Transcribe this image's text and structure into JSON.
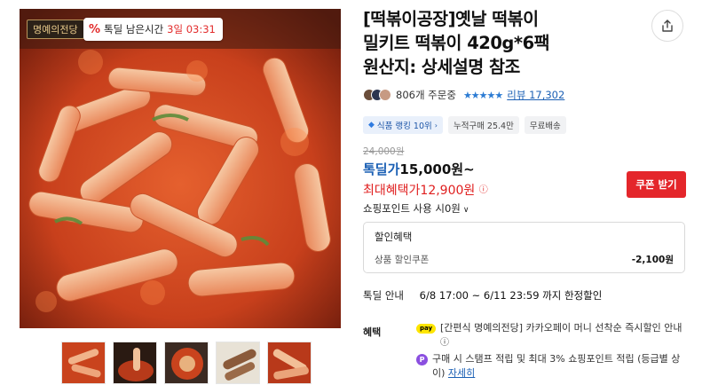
{
  "gallery": {
    "hof_badge": "명예의전당",
    "timer_label": "톡딜 남은시간",
    "timer_value": "3일 03:31",
    "thumbnails": [
      "thumbnail-1",
      "thumbnail-2",
      "thumbnail-3",
      "thumbnail-4",
      "thumbnail-5"
    ]
  },
  "product": {
    "title": "[떡볶이공장]옛날 떡볶이\n밀키트 떡볶이 420g*6팩\n원산지: 상세설명 참조",
    "order_count": "806개 주문중",
    "rating_stars": 5,
    "review_link": "리뷰 17,302",
    "tags": {
      "rank": "식품 랭킹 10위",
      "cumulative": "누적구매 25.4만",
      "shipping": "무료배송"
    },
    "original_price": "24,000원",
    "deal_label": "톡딜가",
    "deal_price": "15,000원~",
    "max_benefit_label": "최대혜택가",
    "max_benefit_price": "12,900원",
    "coupon_button": "쿠폰 받기",
    "points_usage": "쇼핑포인트 사용 시0원",
    "discount": {
      "heading": "할인혜택",
      "coupon_label": "상품 할인쿠폰",
      "coupon_amount": "-2,100원"
    },
    "special": {
      "label": "톡딜 안내",
      "value": "6/8 17:00 ~ 6/11 23:59 까지 한정할인"
    },
    "benefits": {
      "label": "혜택",
      "pay_badge": "pay",
      "items": [
        "[간편식 명예의전당] 카카오페이 머니 선착순 즉시할인 안내",
        "구매 시 스탬프 적립 및 최대 3% 쇼핑포인트 적립 (등급별 상이)"
      ],
      "points_badge": "P",
      "details_link": "자세히"
    }
  },
  "colors": {
    "deal_blue": "#1a5fb4",
    "benefit_red": "#e02020",
    "coupon_button": "#e4262b"
  },
  "icons": {
    "share": "share-icon",
    "info": "info-icon",
    "chevron": "chevron-down-icon"
  }
}
